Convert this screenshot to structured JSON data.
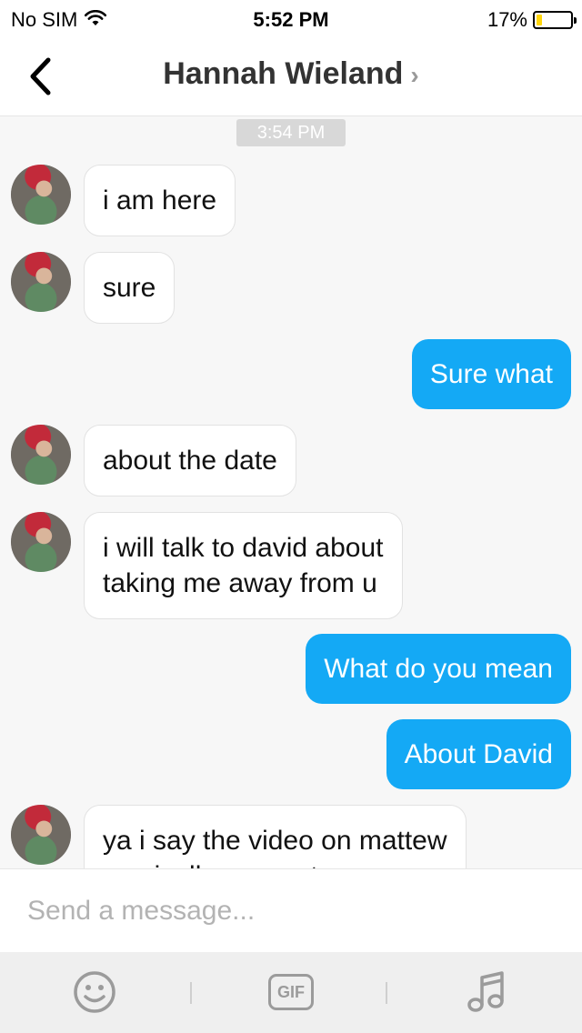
{
  "status": {
    "carrier": "No SIM",
    "time": "5:52 PM",
    "battery": "17%",
    "battery_level": 0.17
  },
  "header": {
    "title": "Hannah Wieland",
    "chevron": "›"
  },
  "chat": {
    "timestamp": "3:54 PM",
    "messages": [
      {
        "from": "them",
        "text": "i am here"
      },
      {
        "from": "them",
        "text": "sure"
      },
      {
        "from": "me",
        "text": "Sure what"
      },
      {
        "from": "them",
        "text": "about the date"
      },
      {
        "from": "them",
        "text": "i will talk to david about\ntaking me away from u"
      },
      {
        "from": "me",
        "text": "What do you mean"
      },
      {
        "from": "me",
        "text": "About David"
      },
      {
        "from": "them",
        "text": "ya i say the video on mattew\nmusically account"
      }
    ]
  },
  "composer": {
    "placeholder": "Send a message...",
    "value": ""
  },
  "toolbar": {
    "gif_label": "GIF",
    "icons": [
      "emoji-icon",
      "gif-icon",
      "music-icon"
    ]
  },
  "colors": {
    "outgoing_bubble": "#14a9f5",
    "incoming_bubble": "#ffffff",
    "battery_fill": "#ffd60a"
  }
}
